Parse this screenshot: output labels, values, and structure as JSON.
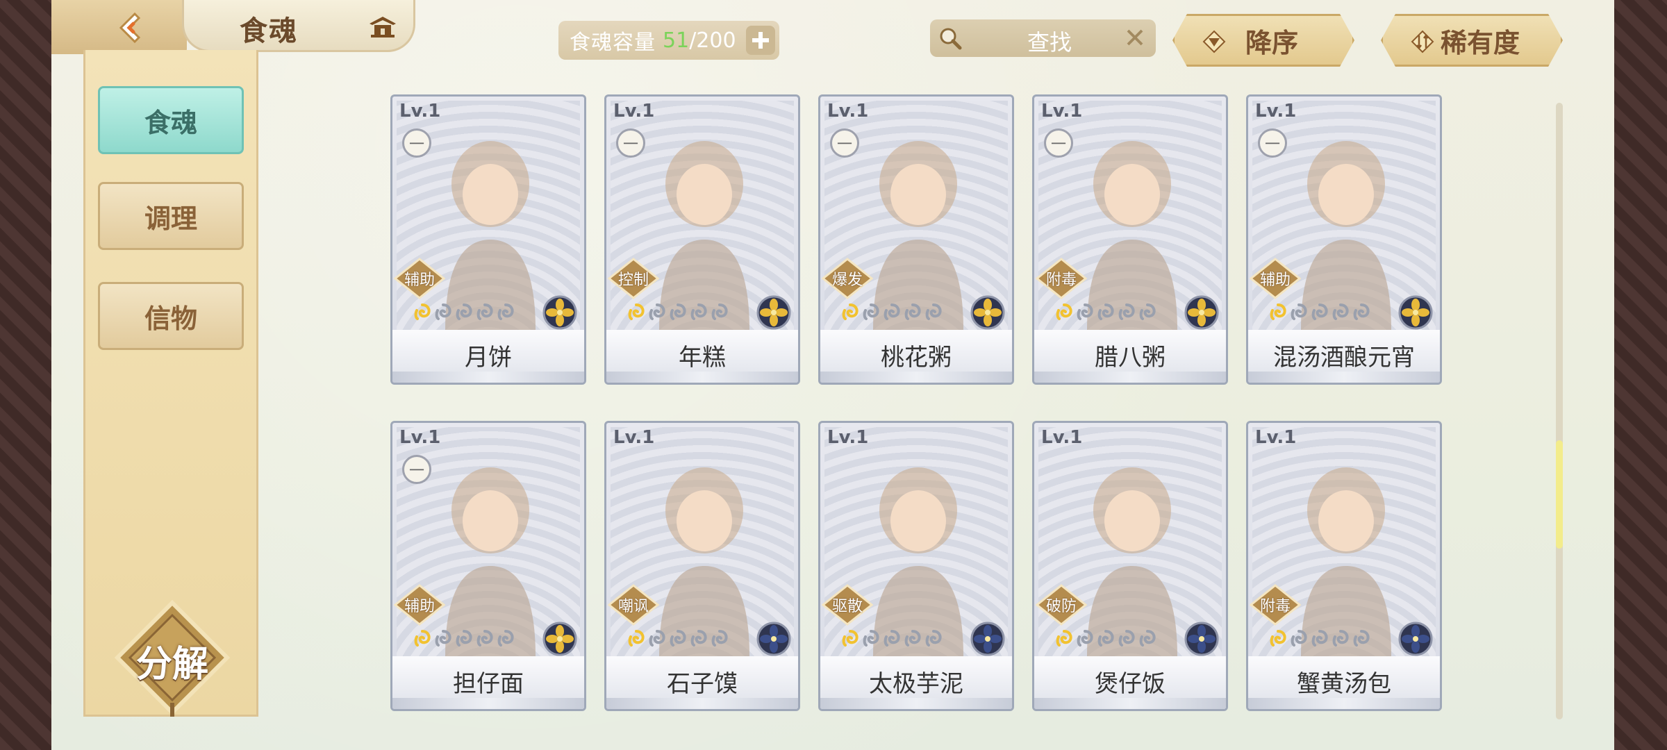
{
  "topbar": {
    "title": "食魂",
    "capacity": {
      "label": "食魂容量",
      "current": "51",
      "separator": "/",
      "max": "200"
    },
    "search": {
      "placeholder": "查找"
    },
    "sort_order_label": "降序",
    "sort_key_label": "稀有度"
  },
  "sidebar": {
    "tabs": [
      {
        "label": "食魂",
        "active": true
      },
      {
        "label": "调理",
        "active": false
      },
      {
        "label": "信物",
        "active": false
      }
    ],
    "decompose_label": "分解"
  },
  "cards": [
    {
      "level": "Lv.1",
      "tier": "一",
      "role": "辅助",
      "stars": 1,
      "element": "gold",
      "name": "月饼"
    },
    {
      "level": "Lv.1",
      "tier": "一",
      "role": "控制",
      "stars": 1,
      "element": "gold",
      "name": "年糕"
    },
    {
      "level": "Lv.1",
      "tier": "一",
      "role": "爆发",
      "stars": 1,
      "element": "gold",
      "name": "桃花粥"
    },
    {
      "level": "Lv.1",
      "tier": "一",
      "role": "附毒",
      "stars": 1,
      "element": "gold",
      "name": "腊八粥"
    },
    {
      "level": "Lv.1",
      "tier": "一",
      "role": "辅助",
      "stars": 1,
      "element": "gold",
      "name": "混汤酒酿元宵"
    },
    {
      "level": "Lv.1",
      "tier": "一",
      "role": "辅助",
      "stars": 1,
      "element": "gold",
      "name": "担仔面"
    },
    {
      "level": "Lv.1",
      "tier": "",
      "role": "嘲讽",
      "stars": 1,
      "element": "blue",
      "name": "石子馍"
    },
    {
      "level": "Lv.1",
      "tier": "",
      "role": "驱散",
      "stars": 1,
      "element": "blue",
      "name": "太极芋泥"
    },
    {
      "level": "Lv.1",
      "tier": "",
      "role": "破防",
      "stars": 1,
      "element": "blue",
      "name": "煲仔饭"
    },
    {
      "level": "Lv.1",
      "tier": "",
      "role": "附毒",
      "stars": 1,
      "element": "blue",
      "name": "蟹黄汤包"
    }
  ],
  "colors": {
    "card_border": "#9fa8b8",
    "element_gold": "#e8b93a",
    "element_blue": "#3c4f8a",
    "star_on": "#f2c230",
    "star_off": "#9aa0ad"
  },
  "icons": [
    "back-icon",
    "home-icon",
    "plus-icon",
    "search-icon",
    "close-icon",
    "sort-desc-icon",
    "sort-rarity-icon",
    "decompose-icon"
  ]
}
